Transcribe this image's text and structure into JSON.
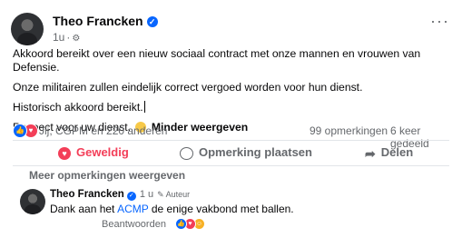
{
  "post": {
    "author": "Theo Francken",
    "time": "1u",
    "body": [
      "Akkoord bereikt over een nieuw sociaal contract met onze mannen en vrouwen van Defensie.",
      "Onze militairen zullen eindelijk correct vergoed worden voor hun dienst.",
      "Historisch akkoord bereikt.",
      "Respect voor uw dienst."
    ],
    "see_less": "Minder weergeven"
  },
  "stats": {
    "reactions": "Jij, CGPM en 220 anderen",
    "comments": "99 opmerkingen",
    "shares": "6 keer gedeeld"
  },
  "actions": {
    "like": "Geweldig",
    "comment": "Opmerking plaatsen",
    "share": "Delen"
  },
  "more_comments": "Meer opmerkingen weergeven",
  "comment": {
    "author": "Theo Francken",
    "time": "1 u",
    "tag": "Auteur",
    "text_before": "Dank aan het ",
    "mention": "ACMP",
    "text_after": " de enige vakbond met ballen.",
    "reply": "Beantwoorden"
  },
  "icons": {
    "verified": "verified-badge-icon",
    "privacy": "gear-icon",
    "more": "more-options-icon",
    "like": "like-reaction-icon",
    "love": "love-reaction-icon",
    "haha": "haha-reaction-icon",
    "comment": "comment-bubble-icon",
    "share": "share-arrow-icon"
  },
  "colors": {
    "accent": "#0866ff",
    "love": "#f33e58",
    "muted": "#65686c",
    "text": "#080809"
  }
}
